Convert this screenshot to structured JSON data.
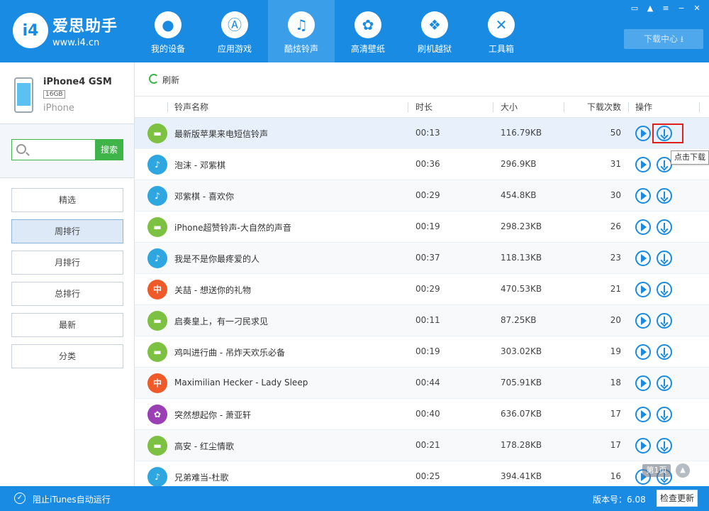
{
  "app": {
    "logo_badge": "i4",
    "name": "爱思助手",
    "url": "www.i4.cn"
  },
  "nav": [
    {
      "label": "我的设备",
      "icon": "apple-icon"
    },
    {
      "label": "应用游戏",
      "icon": "appstore-icon"
    },
    {
      "label": "酷炫铃声",
      "icon": "bell-icon"
    },
    {
      "label": "高清壁纸",
      "icon": "flower-icon"
    },
    {
      "label": "刷机越狱",
      "icon": "dropbox-icon"
    },
    {
      "label": "工具箱",
      "icon": "tools-icon"
    }
  ],
  "active_nav": 2,
  "download_center": "下载中心 ⭳",
  "device": {
    "name": "iPhone4 GSM",
    "capacity": "16GB",
    "type": "iPhone"
  },
  "search": {
    "value": "",
    "button": "搜索"
  },
  "menu": [
    "精选",
    "周排行",
    "月排行",
    "总排行",
    "最新",
    "分类"
  ],
  "active_menu": 1,
  "toolbar": {
    "refresh": "刷新"
  },
  "table": {
    "headers": {
      "name": "铃声名称",
      "duration": "时长",
      "size": "大小",
      "count": "下载次数",
      "ops": "操作"
    },
    "rows": [
      {
        "name": "最新版苹果来电短信铃声",
        "duration": "00:13",
        "size": "116.79KB",
        "count": "50",
        "icon": "sms"
      },
      {
        "name": "泡沫 - 邓紫棋",
        "duration": "00:36",
        "size": "296.9KB",
        "count": "31",
        "icon": "voice"
      },
      {
        "name": "邓紫棋 - 喜欢你",
        "duration": "00:29",
        "size": "454.8KB",
        "count": "30",
        "icon": "voice"
      },
      {
        "name": "iPhone超赞铃声-大自然的声音",
        "duration": "00:19",
        "size": "298.23KB",
        "count": "26",
        "icon": "sms"
      },
      {
        "name": "我是不是你最疼爱的人",
        "duration": "00:37",
        "size": "118.13KB",
        "count": "23",
        "icon": "voice"
      },
      {
        "name": "关喆 - 想送你的礼物",
        "duration": "00:29",
        "size": "470.53KB",
        "count": "21",
        "icon": "cn"
      },
      {
        "name": "启奏皇上，有一刁民求见",
        "duration": "00:11",
        "size": "87.25KB",
        "count": "20",
        "icon": "sms"
      },
      {
        "name": "鸡叫进行曲 - 吊炸天欢乐必备",
        "duration": "00:19",
        "size": "303.02KB",
        "count": "19",
        "icon": "sms"
      },
      {
        "name": "Maximilian Hecker - Lady Sleep",
        "duration": "00:44",
        "size": "705.91KB",
        "count": "18",
        "icon": "cn"
      },
      {
        "name": "突然想起你 - 萧亚轩",
        "duration": "00:40",
        "size": "636.07KB",
        "count": "17",
        "icon": "flower"
      },
      {
        "name": "高安 - 红尘情歌",
        "duration": "00:21",
        "size": "178.28KB",
        "count": "17",
        "icon": "sms"
      },
      {
        "name": "兄弟难当-杜歌",
        "duration": "00:25",
        "size": "394.41KB",
        "count": "16",
        "icon": "voice"
      }
    ]
  },
  "icon_glyphs": {
    "sms": "▬",
    "voice": "♪",
    "cn": "中",
    "flower": "✿"
  },
  "tooltip": "点击下载",
  "page_indicator": "第1页",
  "status": {
    "itunes": "阻止iTunes自动运行",
    "version": "版本号：6.08",
    "check_update": "检查更新"
  },
  "colors": {
    "brand": "#1a8be3",
    "accent_green": "#3fb549",
    "highlight": "#e02020"
  }
}
